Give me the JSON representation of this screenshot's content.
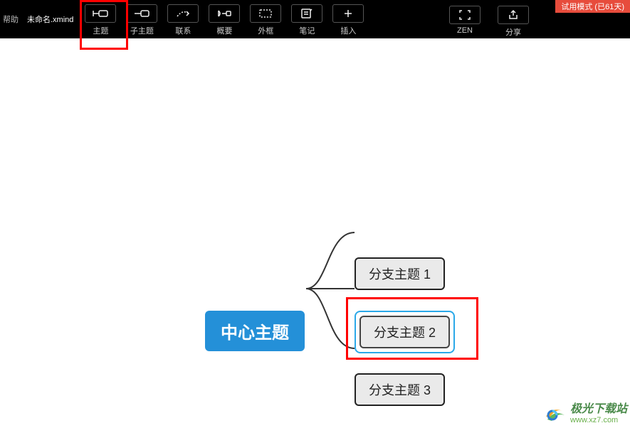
{
  "menu": {
    "help": "帮助"
  },
  "tab_name": "未命名.xmind",
  "trial_badge": "试用模式 (已61天)",
  "toolbar": {
    "topic": "主题",
    "subtopic": "子主题",
    "relation": "联系",
    "summary": "概要",
    "boundary": "外框",
    "note": "笔记",
    "insert": "插入",
    "zen": "ZEN",
    "share": "分享"
  },
  "mindmap": {
    "central": "中心主题",
    "branch1": "分支主题 1",
    "branch2": "分支主题 2",
    "branch3": "分支主题 3"
  },
  "watermark": {
    "cn": "极光下载站",
    "url": "www.xz7.com"
  }
}
